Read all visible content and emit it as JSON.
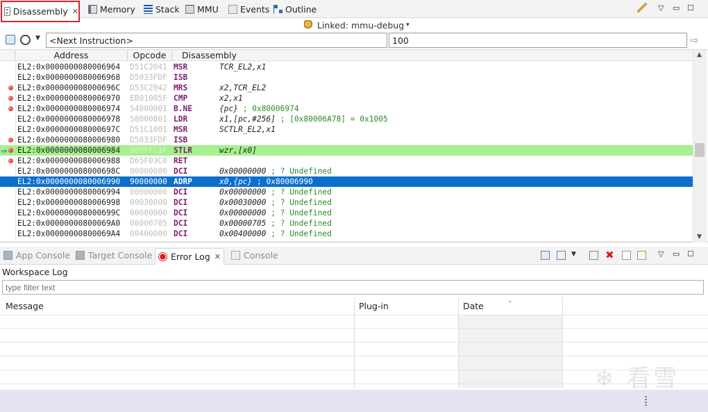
{
  "top_tabs": [
    {
      "label": "Disassembly",
      "close": "✕"
    },
    {
      "label": "Memory"
    },
    {
      "label": "Stack"
    },
    {
      "label": "MMU"
    },
    {
      "label": "Events"
    },
    {
      "label": "Outline"
    }
  ],
  "linked": {
    "label": "Linked: mmu-debug",
    "arrow": "▾"
  },
  "toolbar": {
    "address_value": "<Next Instruction>",
    "count_value": "100",
    "go_arrow": "⇨",
    "history_arrow": "▼"
  },
  "disassembly": {
    "columns": [
      "Address",
      "Opcode",
      "Disassembly"
    ],
    "rows": [
      {
        "addr": "EL2:0x0000000080006964",
        "op": "D51C2041",
        "mn": "MSR",
        "ops": "TCR_EL2,x1",
        "cmt": "",
        "bp": false
      },
      {
        "addr": "EL2:0x0000000080006968",
        "op": "D5033FDF",
        "mn": "ISB",
        "ops": "",
        "cmt": "",
        "bp": false
      },
      {
        "addr": "EL2:0x000000008000696C",
        "op": "D53C2042",
        "mn": "MRS",
        "ops": "x2,TCR_EL2",
        "cmt": "",
        "bp": true
      },
      {
        "addr": "EL2:0x0000000080006970",
        "op": "EB01005F",
        "mn": "CMP",
        "ops": "x2,x1",
        "cmt": "",
        "bp": true
      },
      {
        "addr": "EL2:0x0000000080006974",
        "op": "54000001",
        "mn": "B.NE",
        "ops": "{pc}",
        "cmt": "; 0x80006974",
        "bp": true
      },
      {
        "addr": "EL2:0x0000000080006978",
        "op": "58000801",
        "mn": "LDR",
        "ops": "x1,[pc,#256]",
        "cmt": "; [0x80006A78] = 0x1005",
        "bp": false
      },
      {
        "addr": "EL2:0x000000008000697C",
        "op": "D51C1001",
        "mn": "MSR",
        "ops": "SCTLR_EL2,x1",
        "cmt": "",
        "bp": false
      },
      {
        "addr": "EL2:0x0000000080006980",
        "op": "D5033FDF",
        "mn": "ISB",
        "ops": "",
        "cmt": "",
        "bp": true
      },
      {
        "addr": "EL2:0x0000000080006984",
        "op": "889FFC1F",
        "mn": "STLR",
        "ops": "wzr,[x0]",
        "cmt": "",
        "bp": true,
        "pc": true
      },
      {
        "addr": "EL2:0x0000000080006988",
        "op": "D65F03C0",
        "mn": "RET",
        "ops": "",
        "cmt": "",
        "bp": true
      },
      {
        "addr": "EL2:0x000000008000698C",
        "op": "00000000",
        "mn": "DCI",
        "ops": "0x00000000",
        "cmt": "; ? Undefined",
        "bp": false
      },
      {
        "addr": "EL2:0x0000000080006990",
        "op": "90000000",
        "mn": "ADRP",
        "ops": "x0,{pc}",
        "cmt": "; 0x80006990",
        "bp": false,
        "sel": true
      },
      {
        "addr": "EL2:0x0000000080006994",
        "op": "00000000",
        "mn": "DCI",
        "ops": "0x00000000",
        "cmt": "; ? Undefined",
        "bp": false
      },
      {
        "addr": "EL2:0x0000000080006998",
        "op": "00030000",
        "mn": "DCI",
        "ops": "0x00030000",
        "cmt": "; ? Undefined",
        "bp": false
      },
      {
        "addr": "EL2:0x000000008000699C",
        "op": "00000000",
        "mn": "DCI",
        "ops": "0x00000000",
        "cmt": "; ? Undefined",
        "bp": false
      },
      {
        "addr": "EL2:0x00000000800069A0",
        "op": "00000705",
        "mn": "DCI",
        "ops": "0x00000705",
        "cmt": "; ? Undefined",
        "bp": false
      },
      {
        "addr": "EL2:0x00000000800069A4",
        "op": "00400000",
        "mn": "DCI",
        "ops": "0x00400000",
        "cmt": "; ? Undefined",
        "bp": false
      }
    ]
  },
  "bottom_tabs": [
    {
      "label": "App Console"
    },
    {
      "label": "Target Console"
    },
    {
      "label": "Error Log",
      "close": "✕"
    },
    {
      "label": "Console"
    }
  ],
  "error_log": {
    "title": "Workspace Log",
    "filter_placeholder": "type filter text",
    "columns": [
      "Message",
      "Plug-in",
      "Date"
    ],
    "sort_indicator": "⌄"
  },
  "window_controls": {
    "menu": "▽",
    "minimize": "▭",
    "maximize": "☐"
  },
  "watermark": "❄ 看雪"
}
